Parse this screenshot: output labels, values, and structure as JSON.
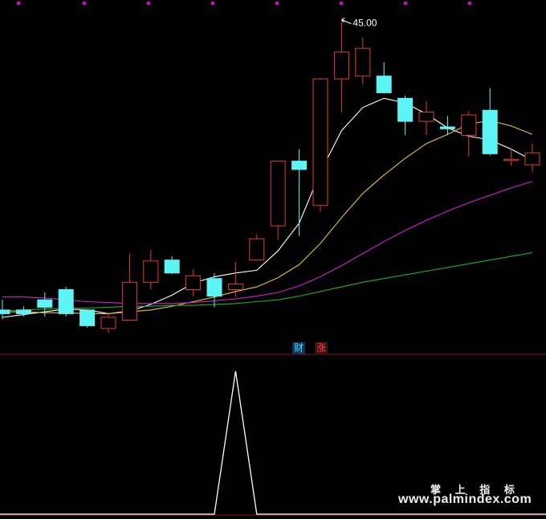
{
  "chart_data": {
    "type": "candlestick",
    "price_panel": {
      "ylim": [
        11.5,
        46.0
      ],
      "max_label": "45.00",
      "candles": [
        {
          "o": 13.6,
          "h": 14.7,
          "l": 12.6,
          "c": 13.2
        },
        {
          "o": 13.6,
          "h": 14.0,
          "l": 12.9,
          "c": 13.2
        },
        {
          "o": 14.7,
          "h": 15.5,
          "l": 12.9,
          "c": 13.9
        },
        {
          "o": 15.8,
          "h": 16.1,
          "l": 12.9,
          "c": 13.2
        },
        {
          "o": 13.6,
          "h": 13.6,
          "l": 11.7,
          "c": 11.9
        },
        {
          "o": 11.6,
          "h": 13.2,
          "l": 11.1,
          "c": 12.8
        },
        {
          "o": 12.5,
          "h": 19.7,
          "l": 12.5,
          "c": 16.6
        },
        {
          "o": 16.6,
          "h": 20.1,
          "l": 15.8,
          "c": 18.9
        },
        {
          "o": 19.0,
          "h": 19.4,
          "l": 17.5,
          "c": 17.6
        },
        {
          "o": 15.8,
          "h": 18.0,
          "l": 15.1,
          "c": 17.3
        },
        {
          "o": 17.0,
          "h": 17.6,
          "l": 13.9,
          "c": 15.1
        },
        {
          "o": 15.8,
          "h": 18.8,
          "l": 15.0,
          "c": 16.4
        },
        {
          "o": 19.0,
          "h": 21.8,
          "l": 18.9,
          "c": 21.3
        },
        {
          "o": 22.7,
          "h": 29.6,
          "l": 21.2,
          "c": 29.7
        },
        {
          "o": 29.7,
          "h": 31.0,
          "l": 21.6,
          "c": 28.8
        },
        {
          "o": 24.9,
          "h": 38.7,
          "l": 24.2,
          "c": 38.6
        },
        {
          "o": 38.6,
          "h": 45.0,
          "l": 35.0,
          "c": 41.5
        },
        {
          "o": 38.9,
          "h": 43.1,
          "l": 38.0,
          "c": 41.9
        },
        {
          "o": 38.9,
          "h": 40.4,
          "l": 37.0,
          "c": 37.1
        },
        {
          "o": 36.5,
          "h": 36.8,
          "l": 32.5,
          "c": 34.0
        },
        {
          "o": 34.0,
          "h": 36.2,
          "l": 32.5,
          "c": 35.0
        },
        {
          "o": 33.4,
          "h": 34.6,
          "l": 32.5,
          "c": 33.2
        },
        {
          "o": 32.5,
          "h": 35.1,
          "l": 30.2,
          "c": 34.7
        },
        {
          "o": 35.2,
          "h": 37.6,
          "l": 30.3,
          "c": 30.5
        },
        {
          "o": 29.8,
          "h": 31.1,
          "l": 29.2,
          "c": 29.9
        },
        {
          "o": 29.3,
          "h": 31.6,
          "l": 28.5,
          "c": 30.6
        }
      ],
      "ma_lines": [
        {
          "name": "MA5",
          "color": "#ffffff",
          "values": [
            12.8,
            13.1,
            13.4,
            13.7,
            13.6,
            13.2,
            13.5,
            14.2,
            15.2,
            16.5,
            17.2,
            17.6,
            17.9,
            20.0,
            23.0,
            28.5,
            33.0,
            35.5,
            36.5,
            36.0,
            34.8,
            33.3,
            32.4,
            32.0,
            31.0,
            29.8
          ]
        },
        {
          "name": "MA10",
          "color": "#e6c234",
          "values": [
            13.4,
            13.4,
            13.3,
            13.3,
            13.2,
            13.2,
            13.4,
            13.6,
            14.0,
            14.5,
            15.0,
            15.6,
            16.1,
            17.1,
            18.5,
            20.8,
            23.6,
            26.2,
            28.2,
            30.0,
            31.6,
            32.6,
            33.7,
            34.1,
            33.5,
            32.6
          ]
        },
        {
          "name": "MA20",
          "color": "#d020d0",
          "values": [
            15.0,
            15.0,
            14.9,
            14.7,
            14.5,
            14.4,
            14.3,
            14.3,
            14.3,
            14.4,
            14.6,
            14.8,
            15.1,
            15.5,
            16.2,
            17.2,
            18.4,
            19.7,
            21.0,
            22.2,
            23.3,
            24.3,
            25.2,
            26.0,
            26.8,
            27.5
          ]
        },
        {
          "name": "MA60",
          "color": "#21b021",
          "values": [
            13.5,
            13.6,
            13.7,
            13.8,
            13.8,
            13.9,
            14.0,
            14.0,
            14.1,
            14.1,
            14.2,
            14.3,
            14.5,
            14.7,
            15.1,
            15.6,
            16.1,
            16.6,
            17.0,
            17.4,
            17.8,
            18.2,
            18.6,
            19.0,
            19.4,
            19.8
          ]
        }
      ],
      "top_markers": 8
    },
    "indicator_panel": {
      "type": "line",
      "ylim": [
        0,
        1
      ],
      "values": [
        0,
        0,
        0,
        0,
        0,
        0,
        0,
        0,
        0,
        0,
        0,
        1,
        0,
        0,
        0,
        0,
        0,
        0,
        0,
        0,
        0,
        0,
        0,
        0,
        0,
        0
      ],
      "color": "#ffffff",
      "labels": [
        "财",
        "涨"
      ]
    },
    "colors": {
      "background": "#000000",
      "up": "#e03a3a",
      "down": "#5cf4f4",
      "separator": "#8b1a1a",
      "marker": "#d000d0"
    }
  },
  "watermark": {
    "title": "掌 上 指 标",
    "url": "www.palmindex.com"
  }
}
